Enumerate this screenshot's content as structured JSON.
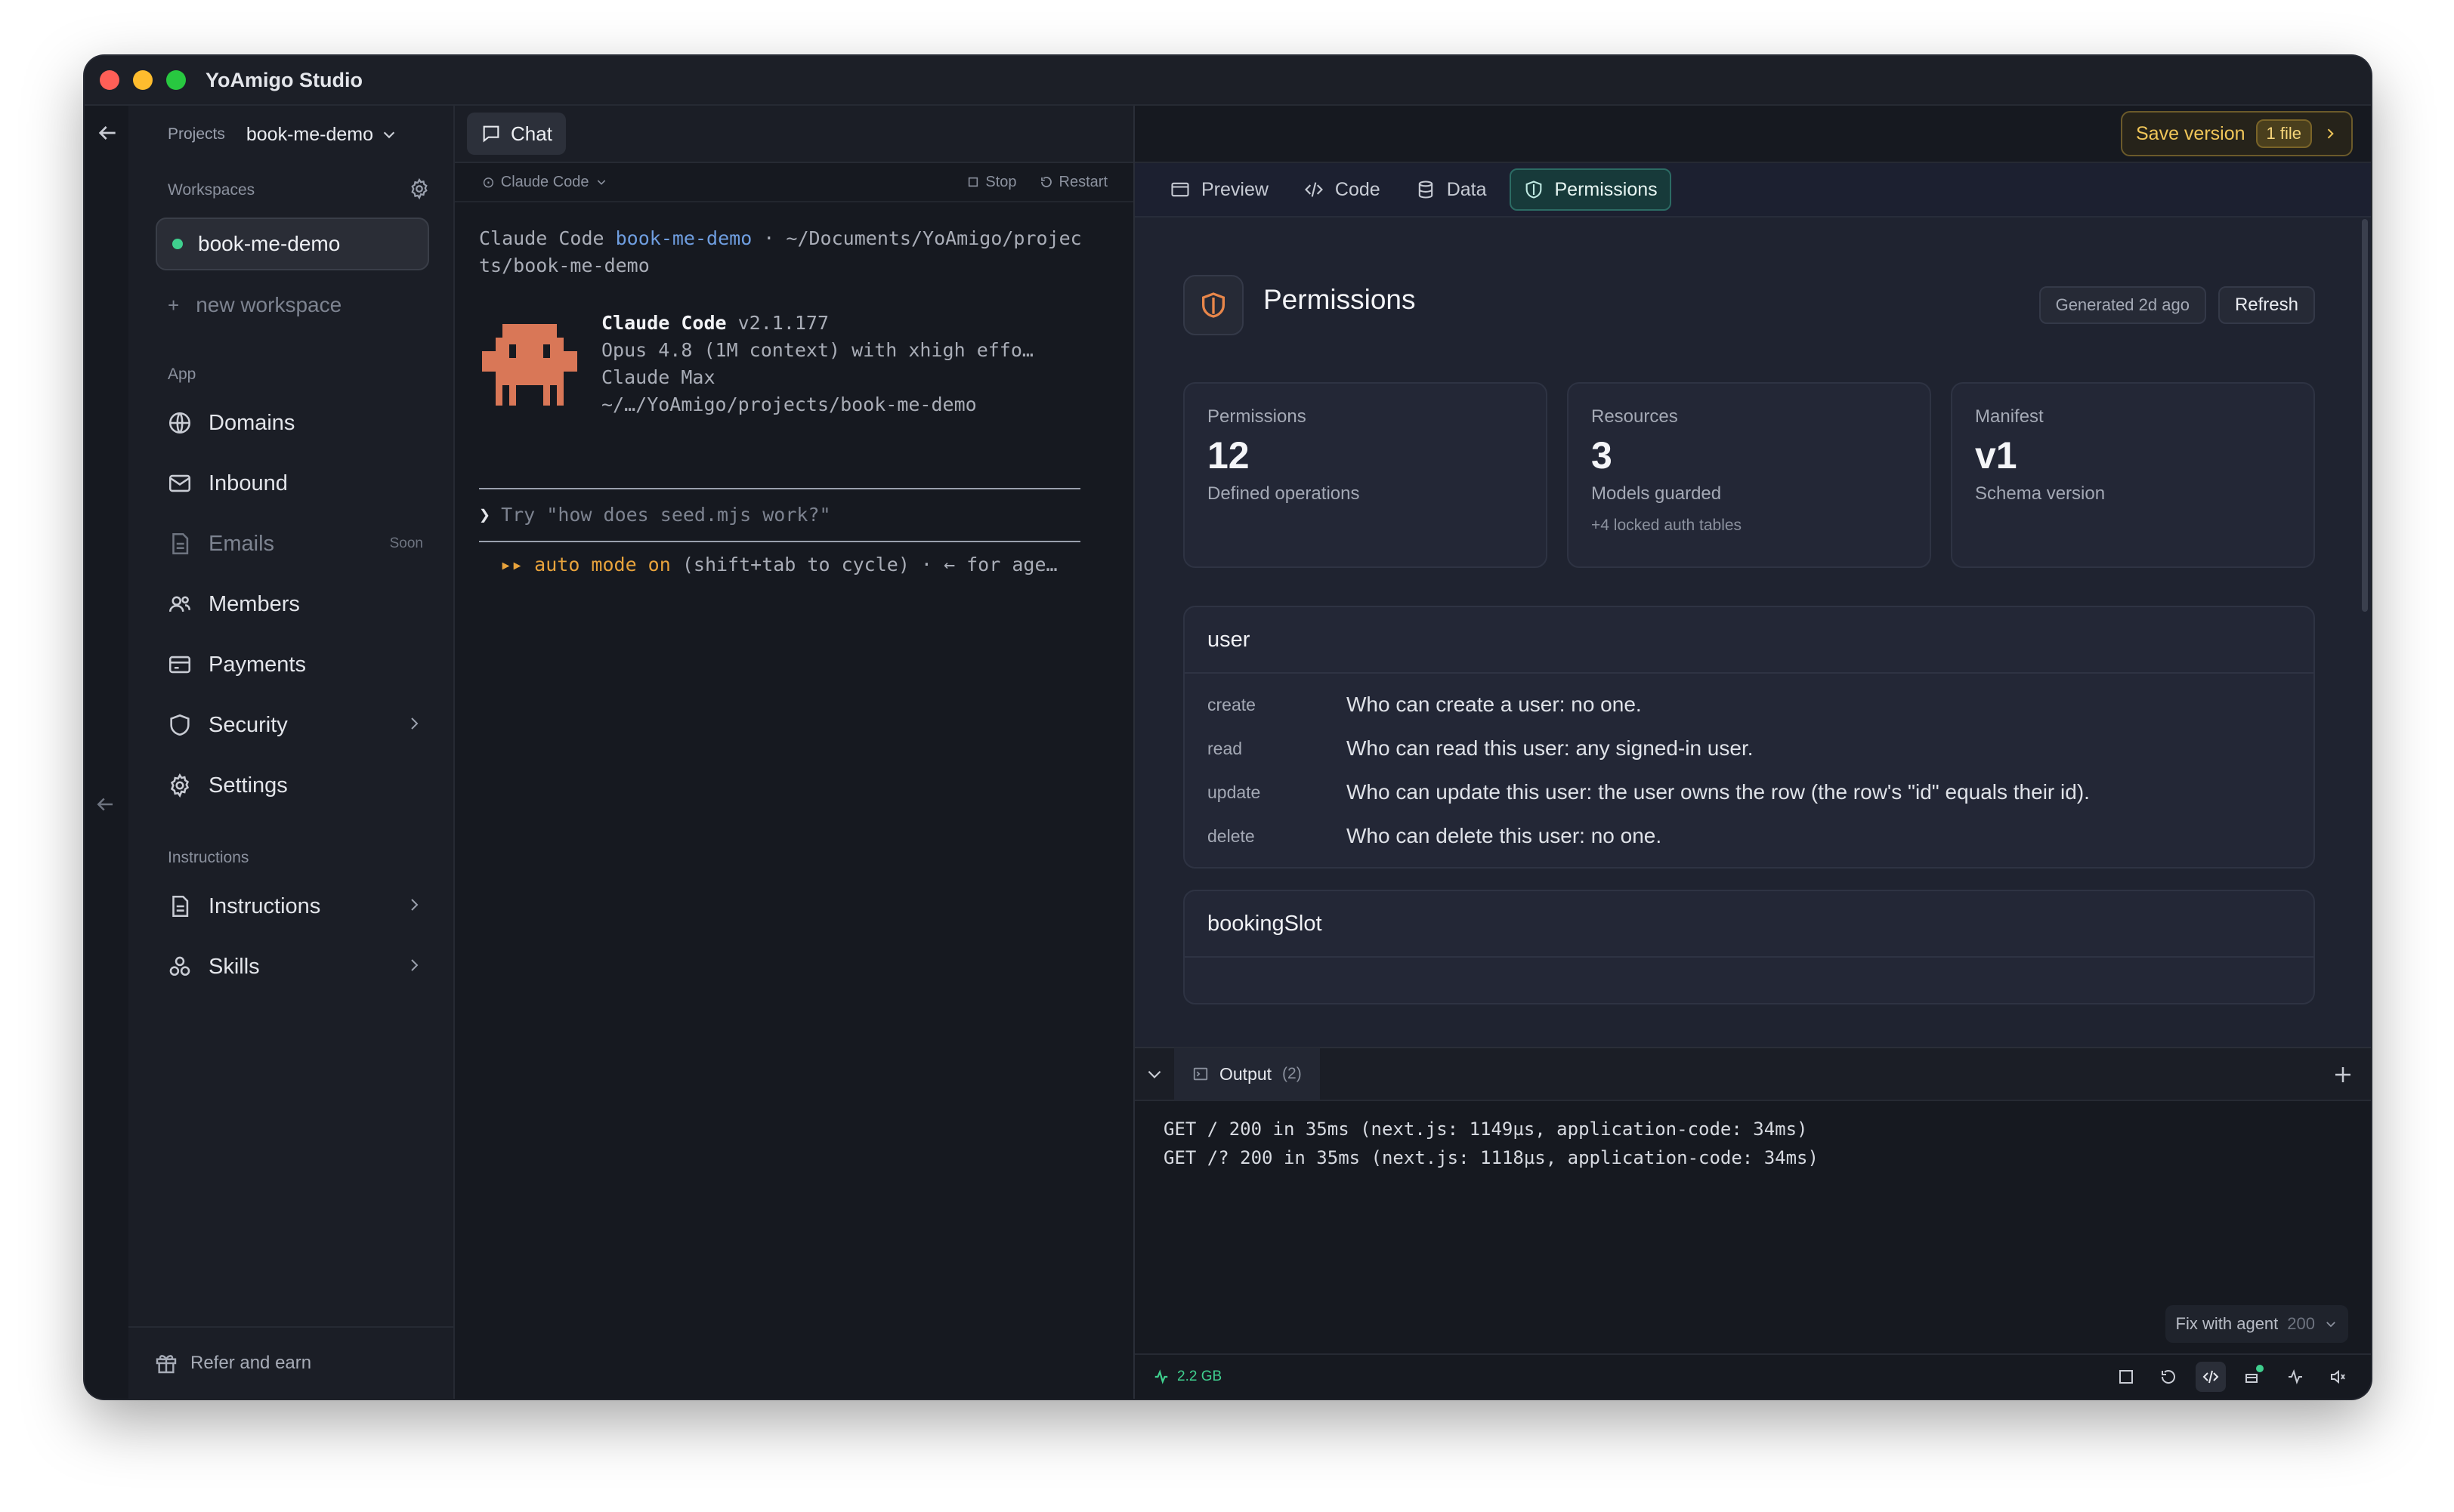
{
  "window": {
    "title": "YoAmigo Studio"
  },
  "sidebar": {
    "projects_label": "Projects",
    "project_name": "book-me-demo",
    "workspaces_title": "Workspaces",
    "active_workspace": "book-me-demo",
    "new_workspace": "new workspace",
    "app_group": "App",
    "app_items": [
      {
        "label": "Domains",
        "icon": "globe-icon"
      },
      {
        "label": "Inbound",
        "icon": "inbox-icon"
      },
      {
        "label": "Emails",
        "icon": "document-icon",
        "badge": "Soon"
      },
      {
        "label": "Members",
        "icon": "users-icon"
      },
      {
        "label": "Payments",
        "icon": "card-icon"
      },
      {
        "label": "Security",
        "icon": "shield-icon"
      },
      {
        "label": "Settings",
        "icon": "gear-icon"
      }
    ],
    "instructions_group": "Instructions",
    "instruction_items": [
      {
        "label": "Instructions",
        "icon": "document-icon"
      },
      {
        "label": "Skills",
        "icon": "skills-icon"
      }
    ],
    "footer": "Refer and earn"
  },
  "chat": {
    "tab": "Chat",
    "agent": "Claude Code",
    "stop": "Stop",
    "restart": "Restart",
    "header_prefix": "Claude Code ",
    "header_link": "book-me-demo",
    "header_path": " · ~/Documents/YoAmigo/projec",
    "header_path2": "ts/book-me-demo",
    "banner_name": "Claude Code",
    "banner_version": " v2.1.177",
    "banner_model": "Opus 4.8 (1M context) with xhigh effo…",
    "banner_plan": "Claude Max",
    "banner_path": "~/…/YoAmigo/projects/book-me-demo",
    "prompt_caret": "❯",
    "prompt_placeholder": "Try \"how does seed.mjs work?\"",
    "mode_arrows": "▸▸",
    "mode_text": "auto mode on",
    "mode_hint": " (shift+tab to cycle) · ← for age…"
  },
  "toolbar": {
    "save_label": "Save version",
    "save_chip": "1 file"
  },
  "view_tabs": [
    {
      "label": "Preview",
      "icon": "preview-icon"
    },
    {
      "label": "Code",
      "icon": "code-icon"
    },
    {
      "label": "Data",
      "icon": "database-icon"
    },
    {
      "label": "Permissions",
      "icon": "shield-icon",
      "active": true
    }
  ],
  "permissions": {
    "title": "Permissions",
    "generated": "Generated 2d ago",
    "refresh": "Refresh",
    "stats": [
      {
        "label": "Permissions",
        "value": "12",
        "desc": "Defined operations",
        "note": ""
      },
      {
        "label": "Resources",
        "value": "3",
        "desc": "Models guarded",
        "note": "+4 locked auth tables"
      },
      {
        "label": "Manifest",
        "value": "v1",
        "desc": "Schema version",
        "note": ""
      }
    ],
    "models": [
      {
        "name": "user",
        "rules": [
          {
            "op": "create",
            "text": "Who can create a user: no one."
          },
          {
            "op": "read",
            "text": "Who can read this user: any signed-in user."
          },
          {
            "op": "update",
            "text": "Who can update this user: the user owns the row (the row's \"id\" equals their id)."
          },
          {
            "op": "delete",
            "text": "Who can delete this user: no one."
          }
        ]
      },
      {
        "name": "bookingSlot",
        "rules": []
      }
    ]
  },
  "output": {
    "tab": "Output",
    "count": "(2)",
    "lines": [
      "GET / 200 in 35ms (next.js: 1149µs, application-code: 34ms)",
      "GET /? 200 in 35ms (next.js: 1118µs, application-code: 34ms)"
    ],
    "fix_label": "Fix with agent",
    "fix_count": "200"
  },
  "status": {
    "memory": "2.2 GB"
  },
  "colors": {
    "accent_green": "#3fcf8e",
    "save_gold": "#f0c659",
    "permissions_active": "#173a3a",
    "shield_orange": "#e8864a",
    "link_blue": "#6f9ee0"
  }
}
